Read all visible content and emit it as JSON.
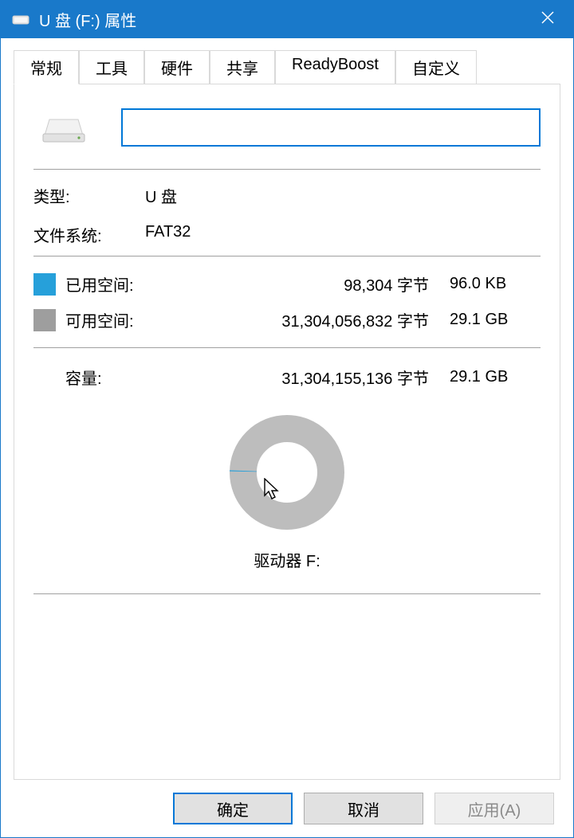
{
  "titlebar": {
    "title": "U 盘 (F:) 属性"
  },
  "tabs": {
    "general": "常规",
    "tools": "工具",
    "hardware": "硬件",
    "sharing": "共享",
    "readyboost": "ReadyBoost",
    "custom": "自定义"
  },
  "general": {
    "name_value": "",
    "type_label": "类型:",
    "type_value": "U 盘",
    "filesystem_label": "文件系统:",
    "filesystem_value": "FAT32",
    "used_label": "已用空间:",
    "used_bytes": "98,304 字节",
    "used_human": "96.0 KB",
    "free_label": "可用空间:",
    "free_bytes": "31,304,056,832 字节",
    "free_human": "29.1 GB",
    "capacity_label": "容量:",
    "capacity_bytes": "31,304,155,136 字节",
    "capacity_human": "29.1 GB",
    "drive_label": "驱动器 F:",
    "swatch_used_color": "#26a0da",
    "swatch_free_color": "#9e9e9e"
  },
  "buttons": {
    "ok": "确定",
    "cancel": "取消",
    "apply": "应用(A)"
  }
}
